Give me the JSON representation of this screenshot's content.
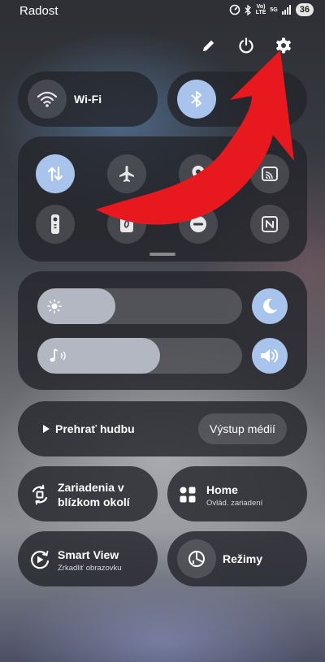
{
  "status_bar": {
    "carrier": "Radost",
    "volte_label": "Vo)\nLTE",
    "network_label": "5G",
    "battery": "36"
  },
  "top_actions": [
    "edit-icon",
    "power-icon",
    "settings-icon"
  ],
  "quick_toggles": {
    "wifi_label": "Wi-Fi",
    "wifi_state": "off",
    "bluetooth_state": "on"
  },
  "toggle_grid": [
    {
      "icon": "mobile-data-icon",
      "state": "on"
    },
    {
      "icon": "airplane-icon",
      "state": "off"
    },
    {
      "icon": "location-icon",
      "state": "off"
    },
    {
      "icon": "cast-icon",
      "state": "off"
    },
    {
      "icon": "remote-icon",
      "state": "off"
    },
    {
      "icon": "power-saving-icon",
      "state": "off"
    },
    {
      "icon": "do-not-disturb-icon",
      "state": "off"
    },
    {
      "icon": "nfc-icon",
      "state": "off"
    }
  ],
  "sliders": {
    "brightness_level": 0.38,
    "volume_level": 0.6,
    "dark_mode_state": "on",
    "sound_state": "on"
  },
  "media": {
    "play_label": "Prehrať hudbu",
    "output_label": "Výstup médií"
  },
  "tiles": {
    "nearby_title": "Zariadenia v blízkom okolí",
    "home_title": "Home",
    "home_sub": "Ovlád. zariadení",
    "smartview_title": "Smart View",
    "smartview_sub": "Zrkadliť obrazovku",
    "modes_title": "Režimy"
  },
  "colors": {
    "accent": "#a8c3ec",
    "annotation_arrow": "#e8191e"
  }
}
